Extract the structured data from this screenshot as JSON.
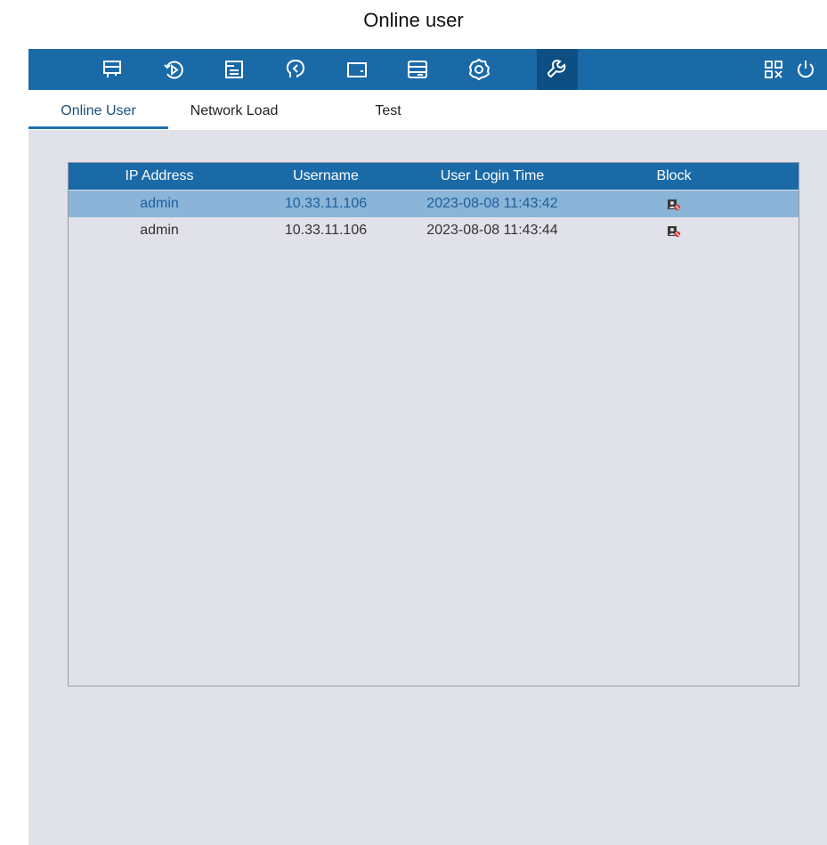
{
  "caption": "Online user",
  "toolbar": {
    "icons": [
      "monitor-icon",
      "playback-icon",
      "file-icon",
      "backup-icon",
      "device-icon",
      "storage-icon",
      "settings-icon",
      "maintenance-icon",
      "qr-code-icon",
      "power-icon"
    ],
    "active": "maintenance-icon",
    "color": "#1a6aa8",
    "active_color": "#0d4f83"
  },
  "tabs": {
    "online_user": "Online User",
    "network_load": "Network Load",
    "test": "Test",
    "active": "Online User"
  },
  "table": {
    "headers": [
      "IP Address",
      "Username",
      "User Login Time",
      "Block"
    ],
    "rows": [
      {
        "ip_address": "admin",
        "username": "10.33.11.106",
        "login_time": "2023-08-08 11:43:42",
        "block_icon": "block-user-icon",
        "selected": true
      },
      {
        "ip_address": "admin",
        "username": "10.33.11.106",
        "login_time": "2023-08-08 11:43:44",
        "block_icon": "block-user-icon",
        "selected": false
      }
    ],
    "selected_row_color": "#8ab4d8",
    "header_color": "#1a6aa8"
  }
}
